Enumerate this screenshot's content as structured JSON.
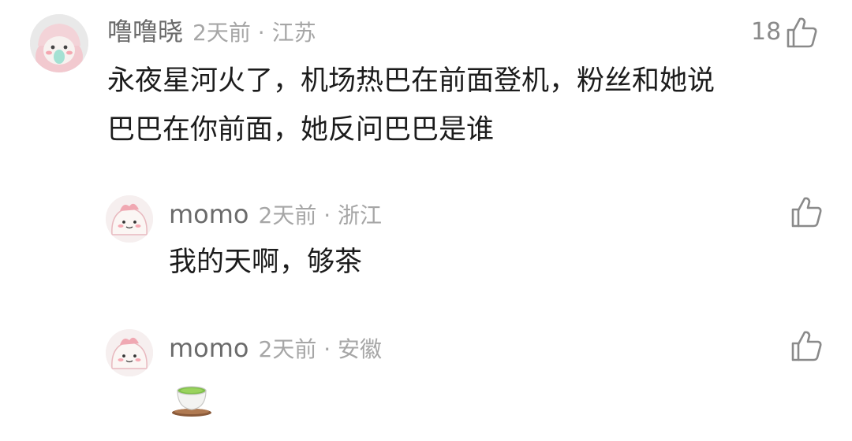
{
  "comments": [
    {
      "username": "噜噜晓",
      "time": "2天前",
      "separator": "·",
      "location": "江苏",
      "like_count": "18",
      "lines": [
        "永夜星河火了，机场热巴在前面登机，粉丝和她说",
        "巴巴在你前面，她反问巴巴是谁"
      ],
      "avatar_icon": "cartoon-face-avatar"
    }
  ],
  "replies": [
    {
      "username": "momo",
      "time": "2天前",
      "separator": "·",
      "location": "浙江",
      "content": "我的天啊，够茶",
      "avatar_icon": "pink-blob-avatar"
    },
    {
      "username": "momo",
      "time": "2天前",
      "separator": "·",
      "location": "安徽",
      "content_emoji": "teacup-emoji",
      "avatar_icon": "pink-blob-avatar"
    }
  ],
  "colors": {
    "username": "#6b6b6b",
    "meta": "#a6a6a6",
    "text": "#1c1c1c",
    "like_icon": "#8a8a8a"
  }
}
